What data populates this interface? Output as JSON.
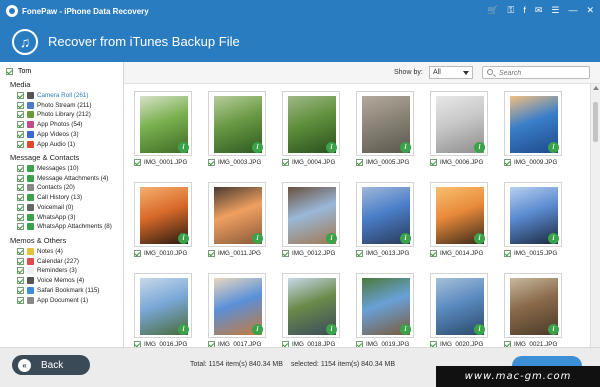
{
  "window": {
    "app_title": "FonePaw - iPhone Data Recovery",
    "icons": [
      "cart-icon",
      "key-icon",
      "facebook-icon",
      "chat-icon",
      "menu-icon",
      "minimize-icon",
      "close-icon"
    ]
  },
  "header": {
    "title": "Recover from iTunes Backup File",
    "icon": "music-note-icon"
  },
  "sidebar": {
    "device": "Tom",
    "groups": [
      {
        "title": "Media",
        "items": [
          {
            "label": "Camera Roll (261)",
            "active": true,
            "color": "#555555"
          },
          {
            "label": "Photo Stream (211)",
            "color": "#4a7cc9"
          },
          {
            "label": "Photo Library (212)",
            "color": "#6a9a3a"
          },
          {
            "label": "App Photos (54)",
            "color": "#c24a8a"
          },
          {
            "label": "App Videos (3)",
            "color": "#3a6ad0"
          },
          {
            "label": "App Audio (1)",
            "color": "#e04a2a"
          }
        ]
      },
      {
        "title": "Message & Contacts",
        "items": [
          {
            "label": "Messages (10)",
            "color": "#3aa34a"
          },
          {
            "label": "Message Attachments (4)",
            "color": "#3aa34a"
          },
          {
            "label": "Contacts (20)",
            "color": "#888888"
          },
          {
            "label": "Call History (13)",
            "color": "#3aa34a"
          },
          {
            "label": "Voicemail (0)",
            "color": "#666666"
          },
          {
            "label": "WhatsApp (3)",
            "color": "#3aa34a"
          },
          {
            "label": "WhatsApp Attachments (8)",
            "color": "#3aa34a"
          }
        ]
      },
      {
        "title": "Memos & Others",
        "items": [
          {
            "label": "Notes (4)",
            "color": "#e6c23a"
          },
          {
            "label": "Calendar (227)",
            "color": "#e04a4a"
          },
          {
            "label": "Reminders (3)",
            "color": "#f0f0f0"
          },
          {
            "label": "Voice Memos (4)",
            "color": "#555555"
          },
          {
            "label": "Safari Bookmark (115)",
            "color": "#3a8fd6"
          },
          {
            "label": "App Document (1)",
            "color": "#888888"
          }
        ]
      }
    ]
  },
  "toolbar": {
    "show_by_label": "Show by:",
    "show_by_value": "All",
    "search_placeholder": "Search"
  },
  "photos": [
    {
      "name": "IMG_0001.JPG",
      "colors": [
        "#7ab050",
        "#3f6b25",
        "#d7e2c8"
      ]
    },
    {
      "name": "IMG_0003.JPG",
      "colors": [
        "#6a9a45",
        "#2e5a20",
        "#b8cc9c"
      ]
    },
    {
      "name": "IMG_0004.JPG",
      "colors": [
        "#5f8f3c",
        "#2a4f1c",
        "#a0b888"
      ]
    },
    {
      "name": "IMG_0005.JPG",
      "colors": [
        "#8a8478",
        "#5b564c",
        "#b3ab9c"
      ]
    },
    {
      "name": "IMG_0006.JPG",
      "colors": [
        "#c8c8c8",
        "#8d8d8d",
        "#e8e8e8"
      ]
    },
    {
      "name": "IMG_0009.JPG",
      "colors": [
        "#3a7ec9",
        "#1d4a8a",
        "#f0c080"
      ]
    },
    {
      "name": "IMG_0010.JPG",
      "colors": [
        "#d96a2a",
        "#2a1a10",
        "#f4b070"
      ]
    },
    {
      "name": "IMG_0011.JPG",
      "colors": [
        "#f0a060",
        "#8a5a3a",
        "#4a3a30"
      ]
    },
    {
      "name": "IMG_0012.JPG",
      "colors": [
        "#9ab8d8",
        "#a07850",
        "#6a5040"
      ]
    },
    {
      "name": "IMG_0013.JPG",
      "colors": [
        "#4a7ec9",
        "#2a3a5a",
        "#a0b8d8"
      ]
    },
    {
      "name": "IMG_0014.JPG",
      "colors": [
        "#e88a3a",
        "#3a2a1a",
        "#f8c070"
      ]
    },
    {
      "name": "IMG_0015.JPG",
      "colors": [
        "#5a8ad0",
        "#1a2a40",
        "#b8d0f0"
      ]
    },
    {
      "name": "IMG_0016.JPG",
      "colors": [
        "#7aa8d8",
        "#4a6a3a",
        "#c8d8e8"
      ]
    },
    {
      "name": "IMG_0017.JPG",
      "colors": [
        "#5a90d8",
        "#c87a3a",
        "#e8d8c0"
      ]
    },
    {
      "name": "IMG_0018.JPG",
      "colors": [
        "#6a8a4a",
        "#3a4a5a",
        "#c8d8e8"
      ]
    },
    {
      "name": "IMG_0019.JPG",
      "colors": [
        "#6aa0d8",
        "#7a5a3a",
        "#4a7a3a"
      ]
    },
    {
      "name": "IMG_0020.JPG",
      "colors": [
        "#5a8ac0",
        "#2a4a6a",
        "#a8c0d8"
      ]
    },
    {
      "name": "IMG_0021.JPG",
      "colors": [
        "#8a6a4a",
        "#4a3a2a",
        "#c8b8a0"
      ]
    }
  ],
  "footer": {
    "back_label": "Back",
    "total": "Total: 1154 item(s) 840.34 MB",
    "selected": "selected: 1154 item(s) 840.34 MB",
    "watermark": "www.mac-gm.com"
  }
}
